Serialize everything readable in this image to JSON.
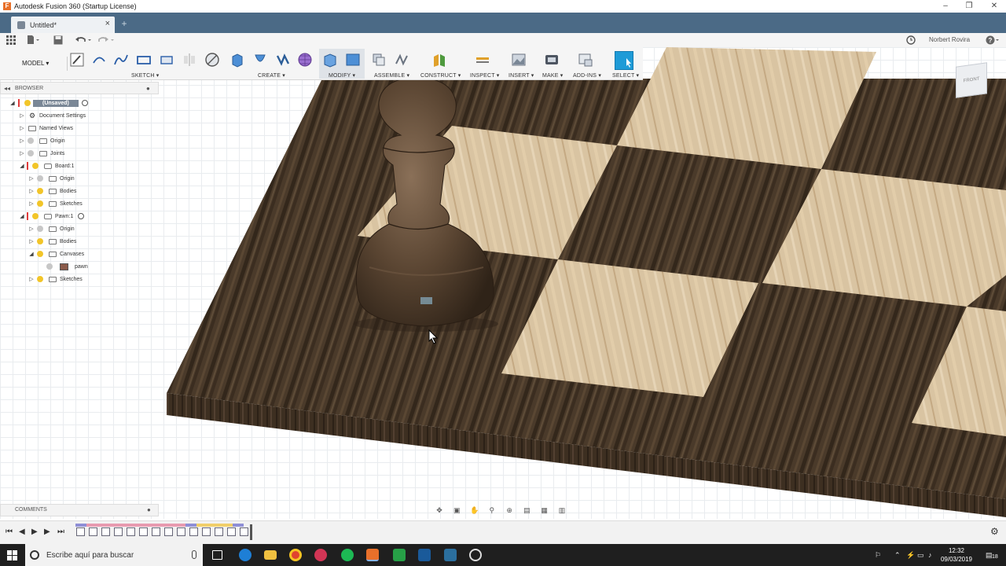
{
  "window": {
    "title": "Autodesk Fusion 360 (Startup License)",
    "controls": {
      "minimize": "–",
      "maximize": "❐",
      "close": "✕"
    }
  },
  "tabs": [
    {
      "label": "Untitled*",
      "close": "×"
    }
  ],
  "new_tab": "+",
  "quick_access": {
    "user_name": "Norbert Rovira",
    "help": "?"
  },
  "toolbar": {
    "workspace": "MODEL",
    "groups": [
      {
        "label": "SKETCH"
      },
      {
        "label": "CREATE"
      },
      {
        "label": "MODIFY"
      },
      {
        "label": "ASSEMBLE"
      },
      {
        "label": "CONSTRUCT"
      },
      {
        "label": "INSPECT"
      },
      {
        "label": "INSERT"
      },
      {
        "label": "MAKE"
      },
      {
        "label": "ADD-INS"
      },
      {
        "label": "SELECT"
      }
    ]
  },
  "browser": {
    "title": "BROWSER",
    "items": [
      {
        "label": "(Unsaved)"
      },
      {
        "label": "Document Settings"
      },
      {
        "label": "Named Views"
      },
      {
        "label": "Origin"
      },
      {
        "label": "Joints"
      },
      {
        "label": "Board:1"
      },
      {
        "label": "Origin"
      },
      {
        "label": "Bodies"
      },
      {
        "label": "Sketches"
      },
      {
        "label": "Pawn:1"
      },
      {
        "label": "Origin"
      },
      {
        "label": "Bodies"
      },
      {
        "label": "Canvases"
      },
      {
        "label": "pawn"
      },
      {
        "label": "Sketches"
      }
    ]
  },
  "viewcube": {
    "label": "FRONT"
  },
  "comments": {
    "title": "COMMENTS"
  },
  "taskbar": {
    "search_placeholder": "Escribe aquí para buscar",
    "time": "12:32",
    "date": "09/03/2019",
    "notification_count": "18"
  },
  "colors": {
    "tab_bar": "#4b6a86",
    "dark_wood": "#4a3a2a",
    "light_wood": "#d8c2a0",
    "select_accent": "#1e9bd7"
  }
}
